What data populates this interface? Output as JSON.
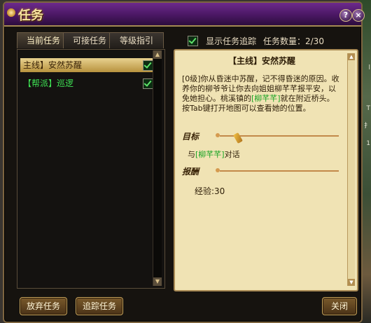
{
  "window": {
    "title": "任务"
  },
  "title_buttons": {
    "help": "?",
    "close": "×"
  },
  "tabs": [
    {
      "label": "当前任务",
      "active": true
    },
    {
      "label": "可接任务",
      "active": false
    },
    {
      "label": "等级指引",
      "active": false
    }
  ],
  "tracking": {
    "label": "显示任务追踪",
    "checked": true
  },
  "count": {
    "text": "任务数量：2/30"
  },
  "quests": [
    {
      "label": "主线】安然苏醒",
      "checked": true,
      "selected": true
    },
    {
      "label": "【帮派】巡逻",
      "checked": true,
      "selected": false
    }
  ],
  "detail": {
    "title": "【主线】安然苏醒",
    "description_part1": "[0级]你从昏迷中苏醒，记不得昏迷的原因。收养你的柳爷爷让你去向姐姐柳芊芊报平安，以免她担心。桃溪镇的",
    "description_npc": "[柳芊芊]",
    "description_part2": "就在附近桥头。按Tab键打开地图可以查看她的位置。",
    "target_heading": "目标",
    "target_prefix": "与",
    "target_npc": "[柳芊芊]",
    "target_suffix": "对话",
    "reward_heading": "报酬",
    "reward_text": "经验:30"
  },
  "buttons": {
    "abandon": "放弃任务",
    "track": "追踪任务",
    "close": "关闭"
  },
  "colors": {
    "title_purple": "#4a1763",
    "accent_gold": "#c8a45c",
    "parchment": "#f0e3b4",
    "npc_green": "#17a323",
    "guild_green": "#3ee053"
  }
}
